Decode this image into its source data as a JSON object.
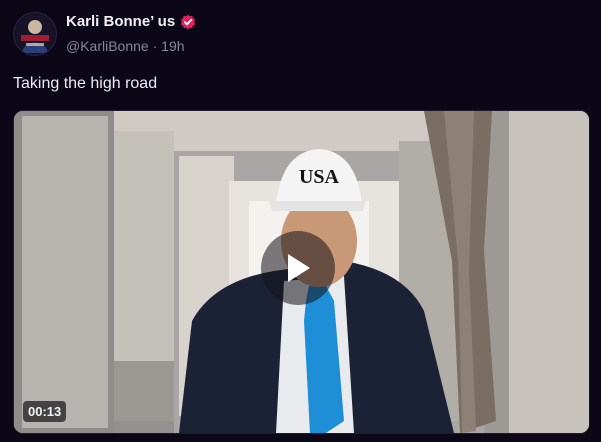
{
  "post": {
    "display_name": "Karli Bonne’ us",
    "handle": "@KarliBonne",
    "separator": "·",
    "timestamp": "19h",
    "text": "Taking the high road",
    "verified_icon": "verified-badge-icon"
  },
  "media": {
    "type": "video",
    "duration": "00:13",
    "play_icon": "play-icon",
    "hat_text": "USA"
  },
  "colors": {
    "background": "#0b0716",
    "verified": "#e0245e",
    "muted_text": "#8b8599",
    "tie": "#1e8fd6"
  }
}
